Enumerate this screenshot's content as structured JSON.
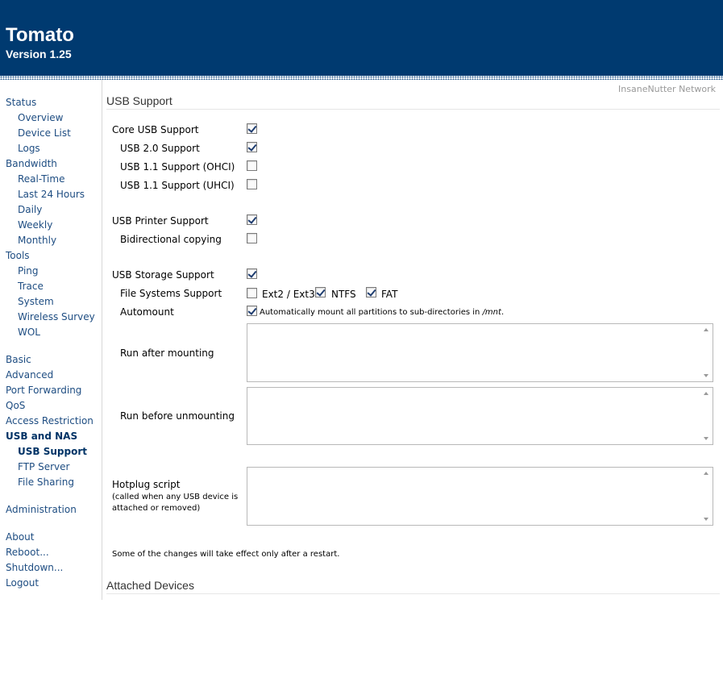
{
  "header": {
    "title": "Tomato",
    "version": "Version 1.25"
  },
  "network_name": "InsaneNutter Network",
  "nav": {
    "status": "Status",
    "overview": "Overview",
    "device_list": "Device List",
    "logs": "Logs",
    "bandwidth": "Bandwidth",
    "real_time": "Real-Time",
    "last24": "Last 24 Hours",
    "daily": "Daily",
    "weekly": "Weekly",
    "monthly": "Monthly",
    "tools": "Tools",
    "ping": "Ping",
    "trace": "Trace",
    "system": "System",
    "wireless_survey": "Wireless Survey",
    "wol": "WOL",
    "basic": "Basic",
    "advanced": "Advanced",
    "port_forwarding": "Port Forwarding",
    "qos": "QoS",
    "access_restriction": "Access Restriction",
    "usb_nas": "USB and NAS",
    "usb_support": "USB Support",
    "ftp_server": "FTP Server",
    "file_sharing": "File Sharing",
    "administration": "Administration",
    "about": "About",
    "reboot": "Reboot...",
    "shutdown": "Shutdown...",
    "logout": "Logout"
  },
  "usb": {
    "section_title": "USB Support",
    "core_label": "Core USB Support",
    "core_checked": true,
    "usb20_label": "USB 2.0 Support",
    "usb20_checked": true,
    "ohci_label": "USB 1.1 Support (OHCI)",
    "ohci_checked": false,
    "uhci_label": "USB 1.1 Support (UHCI)",
    "uhci_checked": false,
    "printer_label": "USB Printer Support",
    "printer_checked": true,
    "bidir_label": "Bidirectional copying",
    "bidir_checked": false,
    "storage_label": "USB Storage Support",
    "storage_checked": true,
    "fs_label": "File Systems Support",
    "ext_label": "Ext2 / Ext3",
    "ext_checked": false,
    "ntfs_label": "NTFS",
    "ntfs_checked": true,
    "fat_label": "FAT",
    "fat_checked": true,
    "automount_label": "Automount",
    "automount_checked": true,
    "automount_desc_prefix": "Automatically mount all partitions to sub-directories in ",
    "automount_desc_path": "/mnt",
    "automount_desc_suffix": ".",
    "run_after_label": "Run after mounting",
    "run_after_value": "",
    "run_before_label": "Run before unmounting",
    "run_before_value": "",
    "hotplug_label": "Hotplug script",
    "hotplug_note": "(called when any USB device is attached or removed)",
    "hotplug_value": "",
    "restart_note": "Some of the changes will take effect only after a restart."
  },
  "attached": {
    "section_title": "Attached Devices"
  }
}
